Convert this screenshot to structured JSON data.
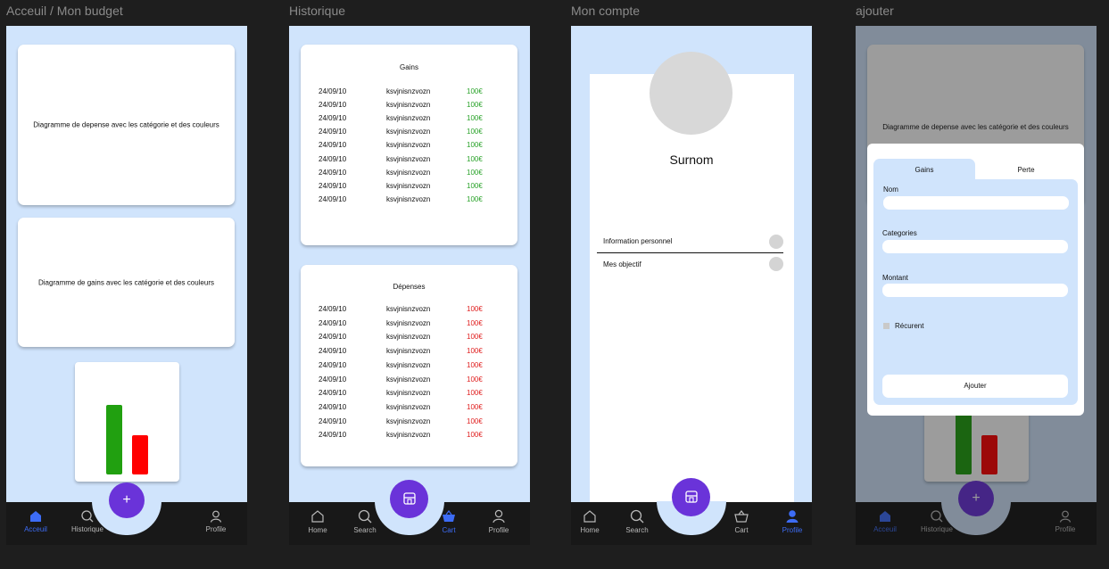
{
  "frames": {
    "accueil": "Acceuil / Mon budget",
    "historique": "Historique",
    "compte": "Mon compte",
    "ajouter": "ajouter"
  },
  "accueil": {
    "card1_text": "Diagramme de depense avec les catégorie et des couleurs",
    "card2_text": "Diagramme de gains avec les catégorie et des couleurs",
    "mini_chart": {
      "bars": [
        {
          "value": 1.0,
          "color": "#21a010"
        },
        {
          "value": 0.56,
          "color": "#ff0000"
        }
      ]
    },
    "fab_label": "+",
    "nav": {
      "accueil": "Acceuil",
      "historique": "Historique",
      "profile": "Profile"
    }
  },
  "historique": {
    "gains_title": "Gains",
    "depenses_title": "Dépenses",
    "gains_rows": [
      {
        "date": "24/09/10",
        "name": "ksvjnisnzvozn",
        "amount": "100€"
      },
      {
        "date": "24/09/10",
        "name": "ksvjnisnzvozn",
        "amount": "100€"
      },
      {
        "date": "24/09/10",
        "name": "ksvjnisnzvozn",
        "amount": "100€"
      },
      {
        "date": "24/09/10",
        "name": "ksvjnisnzvozn",
        "amount": "100€"
      },
      {
        "date": "24/09/10",
        "name": "ksvjnisnzvozn",
        "amount": "100€"
      },
      {
        "date": "24/09/10",
        "name": "ksvjnisnzvozn",
        "amount": "100€"
      },
      {
        "date": "24/09/10",
        "name": "ksvjnisnzvozn",
        "amount": "100€"
      },
      {
        "date": "24/09/10",
        "name": "ksvjnisnzvozn",
        "amount": "100€"
      },
      {
        "date": "24/09/10",
        "name": "ksvjnisnzvozn",
        "amount": "100€"
      }
    ],
    "depenses_rows": [
      {
        "date": "24/09/10",
        "name": "ksvjnisnzvozn",
        "amount": "100€"
      },
      {
        "date": "24/09/10",
        "name": "ksvjnisnzvozn",
        "amount": "100€"
      },
      {
        "date": "24/09/10",
        "name": "ksvjnisnzvozn",
        "amount": "100€"
      },
      {
        "date": "24/09/10",
        "name": "ksvjnisnzvozn",
        "amount": "100€"
      },
      {
        "date": "24/09/10",
        "name": "ksvjnisnzvozn",
        "amount": "100€"
      },
      {
        "date": "24/09/10",
        "name": "ksvjnisnzvozn",
        "amount": "100€"
      },
      {
        "date": "24/09/10",
        "name": "ksvjnisnzvozn",
        "amount": "100€"
      },
      {
        "date": "24/09/10",
        "name": "ksvjnisnzvozn",
        "amount": "100€"
      },
      {
        "date": "24/09/10",
        "name": "ksvjnisnzvozn",
        "amount": "100€"
      },
      {
        "date": "24/09/10",
        "name": "ksvjnisnzvozn",
        "amount": "100€"
      }
    ],
    "nav": {
      "home": "Home",
      "search": "Search",
      "cart": "Cart",
      "profile": "Profile"
    }
  },
  "compte": {
    "surnom": "Surnom",
    "menu": [
      "Information personnel",
      "Mes objectif"
    ],
    "nav": {
      "home": "Home",
      "search": "Search",
      "cart": "Cart",
      "profile": "Profile"
    }
  },
  "ajouter": {
    "bg_card_text": "Diagramme de depense avec les catégorie et des couleurs",
    "tabs": [
      "Gains",
      "Perte"
    ],
    "fields": {
      "nom": "Nom",
      "categories": "Categories",
      "montant": "Montant"
    },
    "recurrent_label": "Récurent",
    "submit": "Ajouter",
    "fab_label": "+",
    "nav": {
      "accueil": "Acceuil",
      "historique": "Historique",
      "profile": "Profile"
    }
  },
  "colors": {
    "accent": "#3d6cf5",
    "fab": "#6a33d9",
    "bg_light": "#d0e4fc"
  }
}
